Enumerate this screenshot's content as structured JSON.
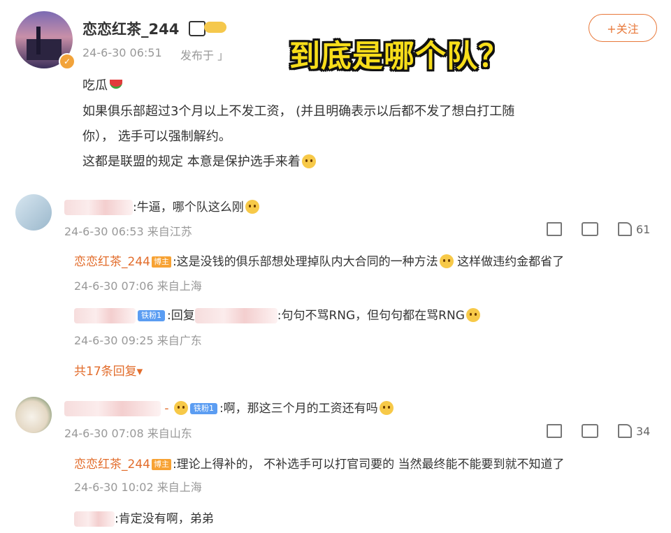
{
  "post": {
    "author": "恋恋红茶_244",
    "time": "24-6-30 06:51",
    "source": "发布于 」",
    "follow_label": "+关注",
    "line1": "吃瓜",
    "line2": "如果俱乐部超过3个月以上不发工资，  (并且明确表示以后都不发了想白打工随",
    "line3": "你）， 选手可以强制解约。",
    "line4": "这都是联盟的规定 本意是保护选手来着"
  },
  "overlay_caption": "到底是哪个队？",
  "comments": [
    {
      "text": ":牛逼，哪个队这么刚",
      "time": "24-6-30 06:53 来自江苏",
      "likes": "61",
      "replies": [
        {
          "author": "恋恋红茶_244",
          "badge": "博主",
          "text": ":这是没钱的俱乐部想处理掉队内大合同的一种方法",
          "text2": "这样做违约金都省了",
          "time": "24-6-30 07:06 来自上海"
        },
        {
          "badge": "铁粉1",
          "text_a": ":回复",
          "text_b": ":句句不骂RNG，但句句都在骂RNG",
          "time": "24-6-30 09:25 来自广东"
        }
      ],
      "more_replies": "共17条回复"
    },
    {
      "badge": "铁粉1",
      "text": ":啊，那这三个月的工资还有吗",
      "time": "24-6-30 07:08 来自山东",
      "likes": "34",
      "replies": [
        {
          "author": "恋恋红茶_244",
          "badge": "博主",
          "text": ":理论上得补的， 不补选手可以打官司要的 当然最终能不能要到就不知道了",
          "time": "24-6-30 10:02 来自上海"
        },
        {
          "text": ":肯定没有啊，弟弟"
        }
      ]
    }
  ],
  "colors": {
    "accent": "#e26c2b",
    "name_link": "#e26c2b",
    "badge_host": "#f7a233",
    "badge_fan": "#5b9df2"
  }
}
